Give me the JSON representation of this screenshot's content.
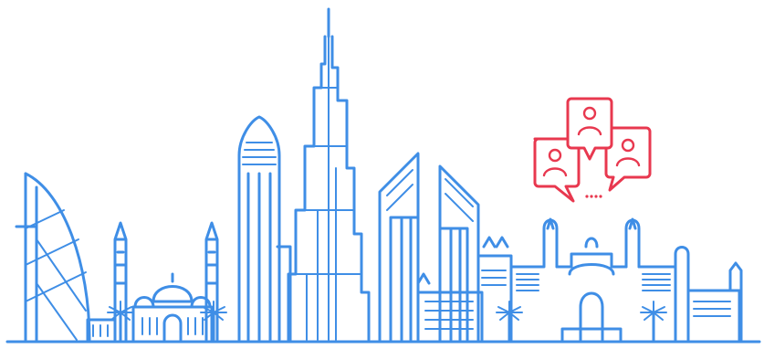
{
  "illustration": {
    "subject": "skyline",
    "icon": "chat-bubbles-people-icon"
  },
  "colors": {
    "line": "#3f8ee6",
    "accent": "#e8384f",
    "background": "#ffffff"
  }
}
